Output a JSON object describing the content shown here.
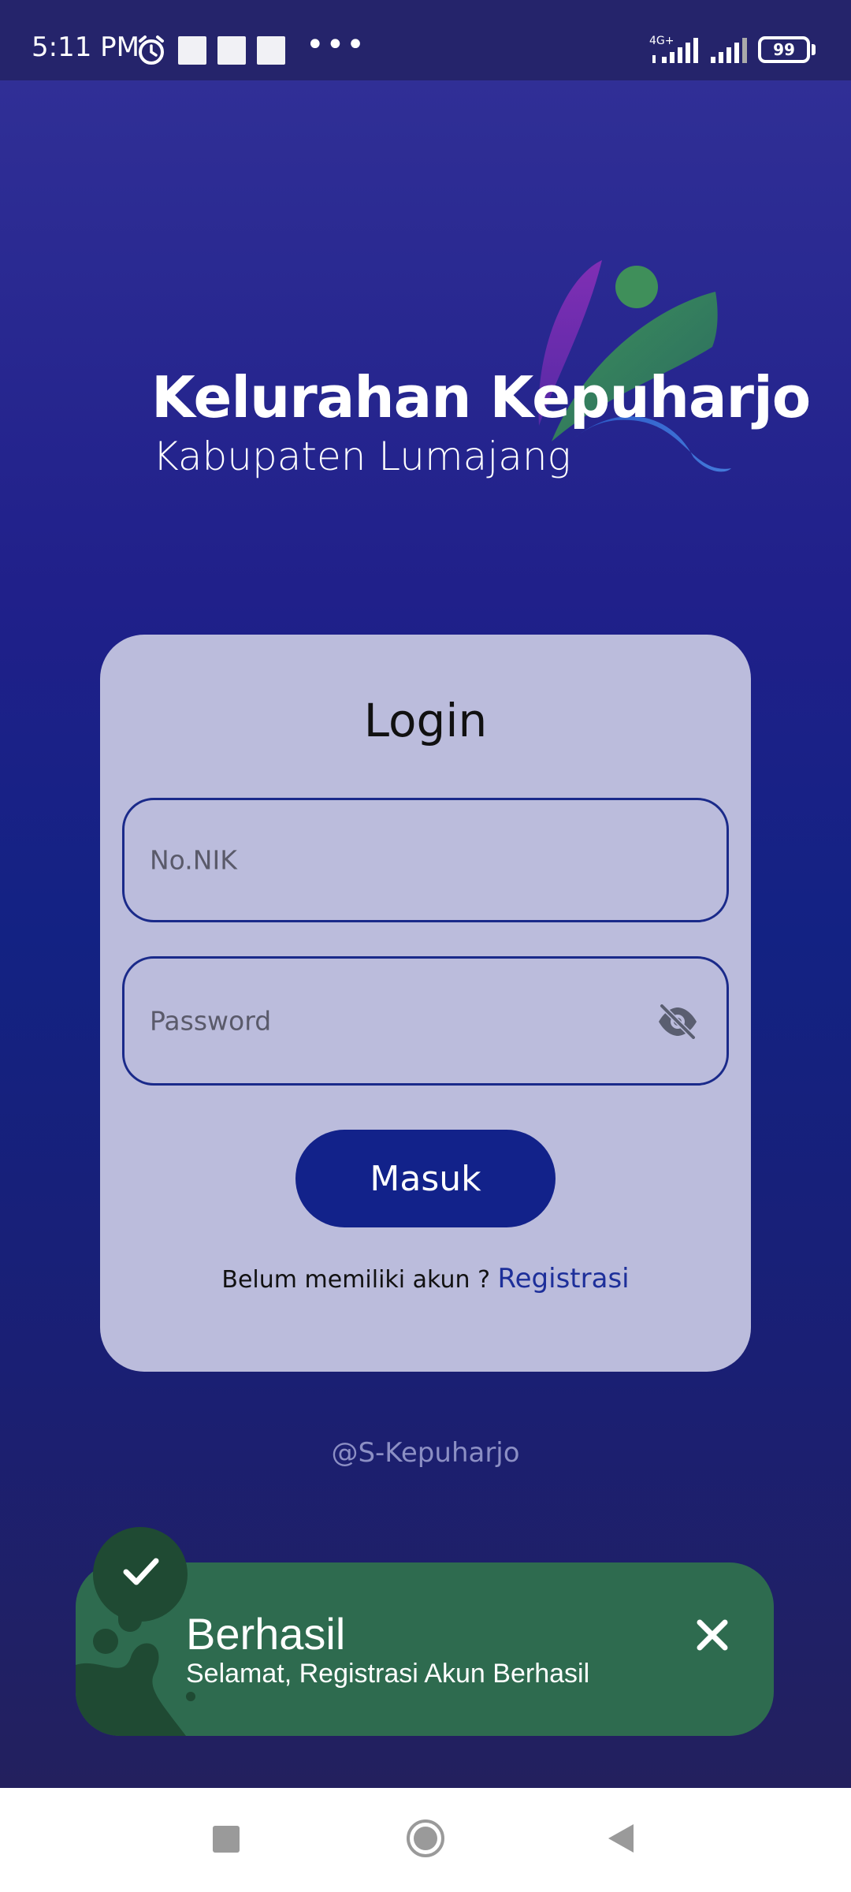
{
  "status_bar": {
    "time": "5:11 PM",
    "network_label": "4G+",
    "battery": "99",
    "overflow": "•••"
  },
  "brand": {
    "title": "Kelurahan Kepuharjo",
    "subtitle": "Kabupaten Lumajang"
  },
  "login": {
    "title": "Login",
    "nik_placeholder": "No.NIK",
    "password_placeholder": "Password",
    "submit_label": "Masuk",
    "register_prompt": "Belum memiliki akun ?",
    "register_link": "Registrasi"
  },
  "footer": {
    "credit": "@S-Kepuharjo"
  },
  "toast": {
    "title": "Berhasil",
    "message": "Selamat, Registrasi Akun Berhasil"
  },
  "icons": {
    "status": [
      "alarm-icon",
      "signal-icon",
      "battery-icon"
    ],
    "field": "eye-off-icon",
    "toast": [
      "check-icon",
      "close-icon"
    ],
    "nav": [
      "recent-apps-icon",
      "home-icon",
      "back-icon"
    ]
  },
  "colors": {
    "primary": "#12228a",
    "card": "#bbbcdc",
    "toast": "#2e6b4f",
    "status_bar": "#25246b"
  }
}
